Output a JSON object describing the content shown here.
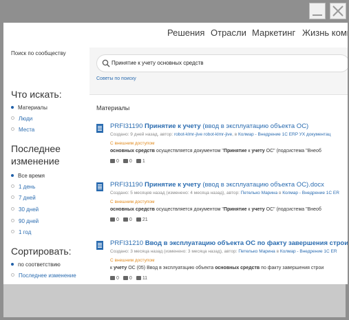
{
  "topnav": [
    "Решения",
    "Отрасли",
    "Маркетинг",
    "Жизнь комп"
  ],
  "sidebar": {
    "search_label": "Поиск по сообществу",
    "what_heading": "Что искать:",
    "what_options": [
      "Материалы",
      "Люди",
      "Места"
    ],
    "changed_heading_1": "Последнее",
    "changed_heading_2": "изменение",
    "changed_options": [
      "Все время",
      "1 день",
      "7 дней",
      "30 дней",
      "90 дней",
      "1 год"
    ],
    "sort_heading": "Сортировать:",
    "sort_options": [
      "по соответствию",
      "Последнее изменение"
    ]
  },
  "search": {
    "query": "Принятие к учету основных средств",
    "tips_link": "Советы по поиску"
  },
  "results": {
    "heading": "Материалы",
    "items": [
      {
        "id": "PRFI31190 ",
        "title_bold": "Принятие к учету",
        "title_rest": " (ввод в эксплуатацию объекта ОС)",
        "meta_prefix": "Создано: 9 дней назад, автор: ",
        "author": "robot-klmr-jive robot-klmr-jive",
        "meta_sep": ", в ",
        "place": "Колмар - Внедрение 1С ERP УХ документац",
        "ext": "С внешним доступом",
        "snip_bold": "основных средств",
        "snip_mid": " осуществляется документом \"",
        "snip_bold2": "Принятие",
        "snip_k": " к ",
        "snip_bold3": "учету",
        "snip_end": " ОС\" (подсистема \"Внеоб",
        "comments": "0",
        "likes": "0",
        "views": "1"
      },
      {
        "id": "PRFI31190 ",
        "title_bold": "Принятие к учету",
        "title_rest": " (ввод в эксплуатацию объекта ОС).docx",
        "meta_prefix": "Создано: 5 месяцев назад (изменено: 4 месяца назад), автор: ",
        "author": "Петелько Марина",
        "meta_sep": " в ",
        "place": "Колмар - Внедрение 1С ER",
        "ext": "С внешним доступом",
        "snip_bold": "основных средств",
        "snip_mid": " осуществляется документом \"",
        "snip_bold2": "Принятие",
        "snip_k": " к ",
        "snip_bold3": "учету",
        "snip_end": " ОС\" (подсистема \"Внеоб",
        "comments": "0",
        "likes": "0",
        "views": "21"
      },
      {
        "id": "PRFI31210 ",
        "title_bold": "Ввод в эксплуатацию объекта ОС по факту завершения строительства, при",
        "title_rest": "",
        "meta_prefix": "Создано: 3 месяца назад (изменено: 3 месяца назад), автор: ",
        "author": "Петелько Марина",
        "meta_sep": " в ",
        "place": "Колмар - Внедрение 1С ER",
        "ext": "С внешним доступом",
        "snip_bold": "учету",
        "snip_pre": "к ",
        "snip_mid": " ОС (05) Ввод в эксплуатацию объекта ",
        "snip_bold2": "основных средств",
        "snip_end": " по факту завершения строи",
        "comments": "0",
        "likes": "0",
        "views": "11"
      }
    ]
  }
}
